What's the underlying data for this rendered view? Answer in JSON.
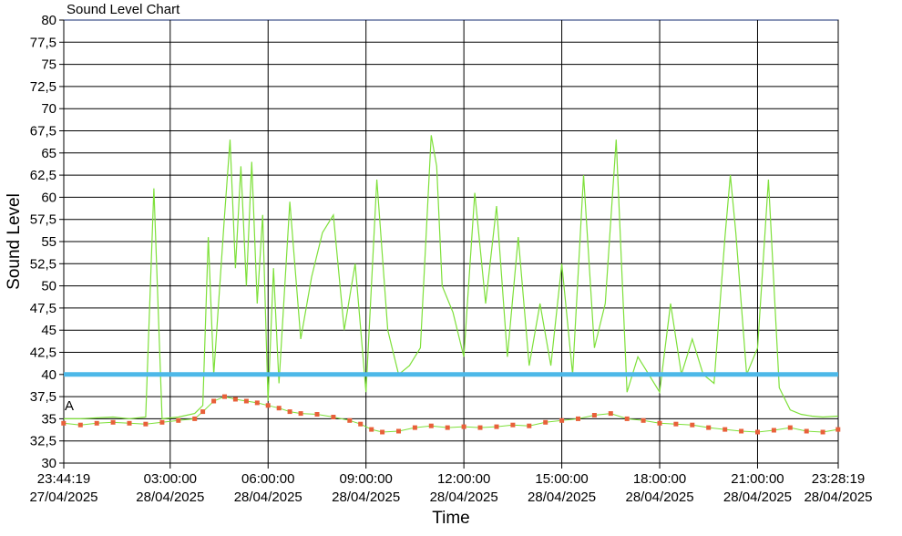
{
  "chart_data": {
    "type": "line",
    "title": "Sound Level Chart",
    "xlabel": "Time",
    "ylabel": "Sound Level",
    "ylim": [
      30,
      80
    ],
    "y_ticks": [
      "30",
      "32,5",
      "35",
      "37,5",
      "40",
      "42,5",
      "45",
      "47,5",
      "50",
      "52,5",
      "55",
      "57,5",
      "60",
      "62,5",
      "65",
      "67,5",
      "70",
      "72,5",
      "75",
      "77,5",
      "80"
    ],
    "x_range": [
      "27/04/2025 23:44:19",
      "28/04/2025 23:28:19"
    ],
    "x_ticks": [
      {
        "time": "23:44:19",
        "date": "27/04/2025"
      },
      {
        "time": "03:00:00",
        "date": "28/04/2025"
      },
      {
        "time": "06:00:00",
        "date": "28/04/2025"
      },
      {
        "time": "09:00:00",
        "date": "28/04/2025"
      },
      {
        "time": "12:00:00",
        "date": "28/04/2025"
      },
      {
        "time": "15:00:00",
        "date": "28/04/2025"
      },
      {
        "time": "18:00:00",
        "date": "28/04/2025"
      },
      {
        "time": "21:00:00",
        "date": "28/04/2025"
      },
      {
        "time": "23:28:19",
        "date": "28/04/2025"
      }
    ],
    "threshold": {
      "value": 40,
      "color": "#4db8e8"
    },
    "annotation": {
      "text": "A",
      "y": 36.5
    },
    "grid": true,
    "colors": {
      "line": "#7ee03a",
      "marker": "#e8603a",
      "grid": "#000000",
      "top_line": "#8a96b8"
    },
    "series": [
      {
        "type": "min_markers",
        "x": [
          "23:44",
          "00:15",
          "00:45",
          "01:15",
          "01:45",
          "02:15",
          "02:45",
          "03:15",
          "03:45",
          "04:00",
          "04:20",
          "04:40",
          "05:00",
          "05:20",
          "05:40",
          "06:00",
          "06:20",
          "06:40",
          "07:00",
          "07:30",
          "08:00",
          "08:30",
          "08:50",
          "09:10",
          "09:30",
          "10:00",
          "10:30",
          "11:00",
          "11:30",
          "12:00",
          "12:30",
          "13:00",
          "13:30",
          "14:00",
          "14:30",
          "15:00",
          "15:30",
          "16:00",
          "16:30",
          "17:00",
          "17:30",
          "18:00",
          "18:30",
          "19:00",
          "19:30",
          "20:00",
          "20:30",
          "21:00",
          "21:30",
          "22:00",
          "22:30",
          "23:00",
          "23:28"
        ],
        "y": [
          34.5,
          34.3,
          34.5,
          34.6,
          34.5,
          34.4,
          34.6,
          34.8,
          35.0,
          35.8,
          37.0,
          37.5,
          37.2,
          37.0,
          36.8,
          36.5,
          36.2,
          35.8,
          35.6,
          35.5,
          35.2,
          34.8,
          34.4,
          33.8,
          33.5,
          33.6,
          34.0,
          34.2,
          34.0,
          34.1,
          34.0,
          34.1,
          34.3,
          34.2,
          34.6,
          34.8,
          35.0,
          35.4,
          35.6,
          35.0,
          34.8,
          34.5,
          34.4,
          34.3,
          34.0,
          33.8,
          33.6,
          33.5,
          33.7,
          34.0,
          33.6,
          33.5,
          33.8
        ]
      },
      {
        "type": "max_line",
        "x": [
          "23:44",
          "00:15",
          "00:45",
          "01:15",
          "01:45",
          "02:15",
          "02:30",
          "02:45",
          "03:15",
          "03:45",
          "04:00",
          "04:10",
          "04:20",
          "04:40",
          "04:50",
          "05:00",
          "05:10",
          "05:20",
          "05:30",
          "05:40",
          "05:50",
          "06:00",
          "06:10",
          "06:20",
          "06:40",
          "07:00",
          "07:20",
          "07:40",
          "08:00",
          "08:20",
          "08:40",
          "09:00",
          "09:20",
          "09:40",
          "10:00",
          "10:20",
          "10:40",
          "11:00",
          "11:10",
          "11:20",
          "11:40",
          "12:00",
          "12:20",
          "12:40",
          "13:00",
          "13:20",
          "13:40",
          "14:00",
          "14:20",
          "14:40",
          "15:00",
          "15:20",
          "15:40",
          "16:00",
          "16:20",
          "16:40",
          "17:00",
          "17:20",
          "17:40",
          "18:00",
          "18:20",
          "18:40",
          "19:00",
          "19:20",
          "19:40",
          "20:00",
          "20:10",
          "20:20",
          "20:40",
          "21:00",
          "21:20",
          "21:40",
          "22:00",
          "22:20",
          "22:40",
          "23:00",
          "23:28"
        ],
        "y": [
          35.0,
          35.0,
          35.1,
          35.2,
          35.0,
          35.2,
          61.0,
          35.0,
          35.2,
          35.6,
          36.5,
          55.5,
          40.0,
          58.0,
          66.5,
          52.0,
          63.5,
          50.0,
          64.0,
          48.0,
          58.0,
          37.0,
          52.0,
          39.0,
          59.5,
          44.0,
          51.0,
          56.0,
          58.0,
          45.0,
          52.5,
          38.0,
          62.0,
          45.0,
          40.0,
          41.0,
          43.0,
          67.0,
          63.5,
          50.0,
          47.0,
          42.0,
          60.5,
          48.0,
          59.0,
          42.0,
          55.5,
          41.0,
          48.0,
          41.0,
          52.5,
          40.0,
          62.5,
          43.0,
          48.0,
          66.5,
          38.0,
          42.0,
          40.0,
          38.0,
          48.0,
          40.0,
          44.0,
          40.0,
          39.0,
          55.5,
          62.5,
          56.0,
          40.0,
          43.0,
          62.0,
          38.5,
          36.0,
          35.5,
          35.3,
          35.2,
          35.3
        ]
      }
    ]
  }
}
